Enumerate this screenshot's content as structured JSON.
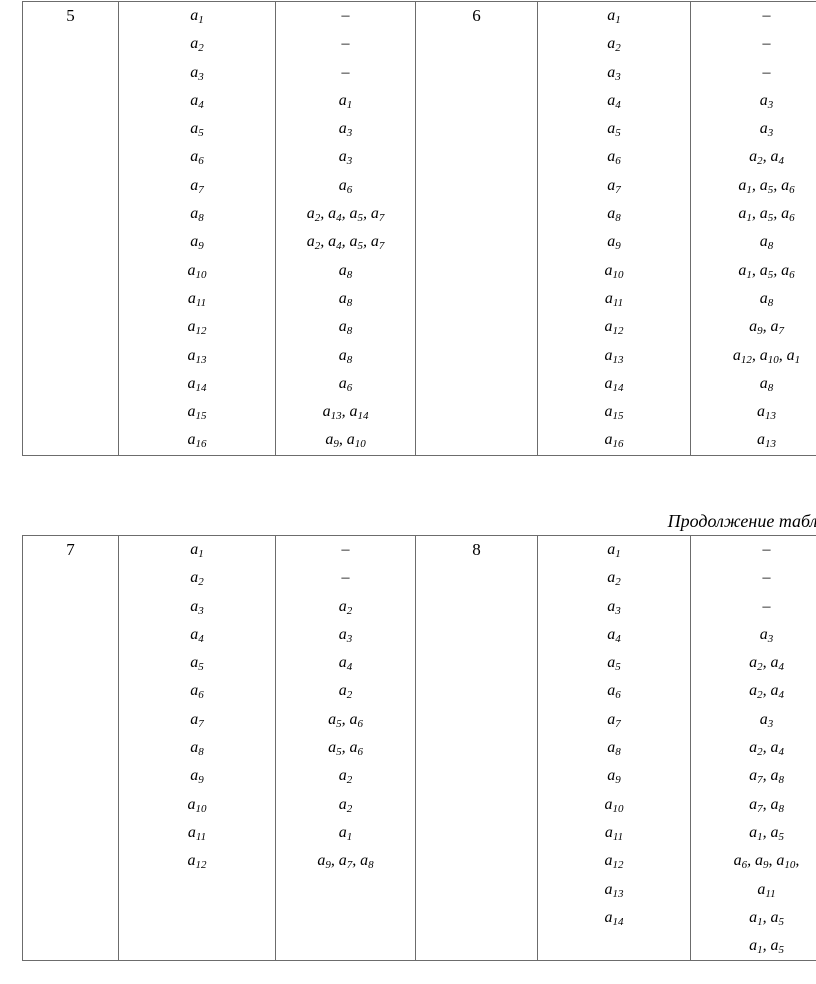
{
  "document": {
    "continuation_caption": "Продолжение табл.",
    "variable_symbol": "a",
    "empty_marker": "–"
  },
  "tables": [
    {
      "id": "table-block-1",
      "blocks": [
        {
          "number": "5",
          "rows": [
            {
              "element": "a1",
              "predecessors": "–"
            },
            {
              "element": "a2",
              "predecessors": "–"
            },
            {
              "element": "a3",
              "predecessors": "–"
            },
            {
              "element": "a4",
              "predecessors": "a1"
            },
            {
              "element": "a5",
              "predecessors": "a3"
            },
            {
              "element": "a6",
              "predecessors": "a3"
            },
            {
              "element": "a7",
              "predecessors": "a6"
            },
            {
              "element": "a8",
              "predecessors": "a2, a4, a5, a7"
            },
            {
              "element": "a9",
              "predecessors": "a2, a4, a5, a7"
            },
            {
              "element": "a10",
              "predecessors": "a8"
            },
            {
              "element": "a11",
              "predecessors": "a8"
            },
            {
              "element": "a12",
              "predecessors": "a8"
            },
            {
              "element": "a13",
              "predecessors": "a8"
            },
            {
              "element": "a14",
              "predecessors": "a6"
            },
            {
              "element": "a15",
              "predecessors": "a13, a14"
            },
            {
              "element": "a16",
              "predecessors": "a9, a10"
            }
          ]
        },
        {
          "number": "6",
          "rows": [
            {
              "element": "a1",
              "predecessors": "–"
            },
            {
              "element": "a2",
              "predecessors": "–"
            },
            {
              "element": "a3",
              "predecessors": "–"
            },
            {
              "element": "a4",
              "predecessors": "a3"
            },
            {
              "element": "a5",
              "predecessors": "a3"
            },
            {
              "element": "a6",
              "predecessors": "a2, a4"
            },
            {
              "element": "a7",
              "predecessors": "a1, a5, a6"
            },
            {
              "element": "a8",
              "predecessors": "a1, a5, a6"
            },
            {
              "element": "a9",
              "predecessors": "a8"
            },
            {
              "element": "a10",
              "predecessors": "a1, a5, a6"
            },
            {
              "element": "a11",
              "predecessors": "a8"
            },
            {
              "element": "a12",
              "predecessors": "a9, a7"
            },
            {
              "element": "a13",
              "predecessors": "a12, a10, a1"
            },
            {
              "element": "a14",
              "predecessors": "a8"
            },
            {
              "element": "a15",
              "predecessors": "a13"
            },
            {
              "element": "a16",
              "predecessors": "a13"
            }
          ]
        }
      ]
    },
    {
      "id": "table-block-2",
      "blocks": [
        {
          "number": "7",
          "rows": [
            {
              "element": "a1",
              "predecessors": "–"
            },
            {
              "element": "a2",
              "predecessors": "–"
            },
            {
              "element": "a3",
              "predecessors": "a2"
            },
            {
              "element": "a4",
              "predecessors": "a3"
            },
            {
              "element": "a5",
              "predecessors": "a4"
            },
            {
              "element": "a6",
              "predecessors": "a2"
            },
            {
              "element": "a7",
              "predecessors": "a5, a6"
            },
            {
              "element": "a8",
              "predecessors": "a5, a6"
            },
            {
              "element": "a9",
              "predecessors": "a2"
            },
            {
              "element": "a10",
              "predecessors": "a2"
            },
            {
              "element": "a11",
              "predecessors": "a1"
            },
            {
              "element": "a12",
              "predecessors": "a9, a7, a8"
            }
          ]
        },
        {
          "number": "8",
          "rows": [
            {
              "element": "a1",
              "predecessors": "–"
            },
            {
              "element": "a2",
              "predecessors": "–"
            },
            {
              "element": "a3",
              "predecessors": "–"
            },
            {
              "element": "a4",
              "predecessors": "a3"
            },
            {
              "element": "a5",
              "predecessors": "a2, a4"
            },
            {
              "element": "a6",
              "predecessors": "a2, a4"
            },
            {
              "element": "a7",
              "predecessors": "a3"
            },
            {
              "element": "a8",
              "predecessors": "a2, a4"
            },
            {
              "element": "a9",
              "predecessors": "a7, a8"
            },
            {
              "element": "a10",
              "predecessors": "a7, a8"
            },
            {
              "element": "a11",
              "predecessors": "a1, a5"
            },
            {
              "element": "a12",
              "predecessors": "a6, a9, a10,"
            },
            {
              "element": "a13",
              "predecessors": "a11"
            },
            {
              "element": "a14",
              "predecessors": "a1, a5"
            },
            {
              "element": "",
              "predecessors": "a1, a5"
            }
          ]
        }
      ]
    }
  ]
}
